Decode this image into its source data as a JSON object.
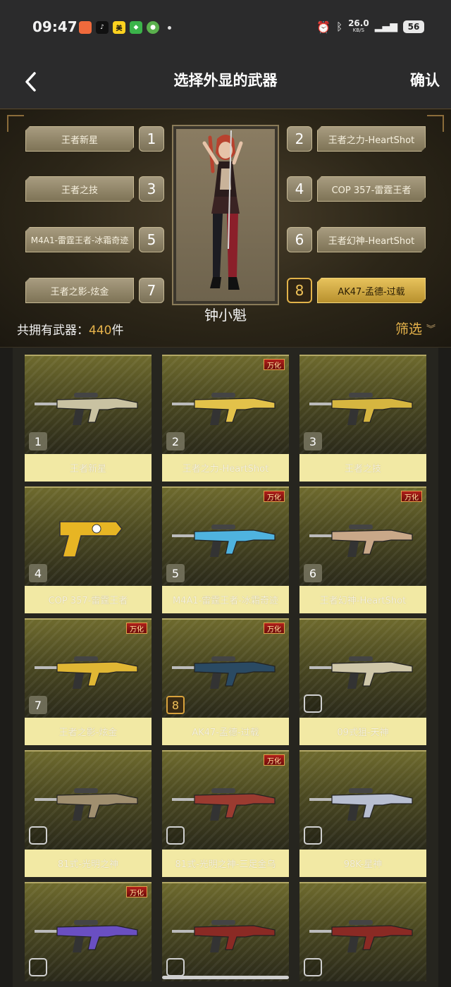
{
  "status_bar": {
    "time": "09:47",
    "apps": [
      "game-app",
      "tiktok-app",
      "meituan-app",
      "shield-app",
      "rings-app"
    ],
    "net_speed": "26.0",
    "net_unit": "KB/S",
    "battery": "56"
  },
  "nav": {
    "back_icon": "back-arrow-icon",
    "title": "选择外显的武器",
    "confirm": "确认"
  },
  "slots": {
    "left": [
      {
        "label": "王者新星",
        "num": "1"
      },
      {
        "label": "王者之技",
        "num": "3"
      },
      {
        "label": "M4A1-雷霆王者-冰霜奇迹",
        "num": "5"
      },
      {
        "label": "王者之影-炫金",
        "num": "7"
      }
    ],
    "right": [
      {
        "label": "王者之力-HeartShot",
        "num": "2"
      },
      {
        "label": "COP 357-雷霆王者",
        "num": "4"
      },
      {
        "label": "王者幻神-HeartShot",
        "num": "6"
      },
      {
        "label": "AK47-孟德-过载",
        "num": "8",
        "active": true
      }
    ]
  },
  "character_name": "钟小魁",
  "owned": {
    "prefix": "共拥有武器：",
    "count": "440",
    "suffix": "件"
  },
  "filter_label": "筛选",
  "tag_text": "万化",
  "weapons": [
    {
      "name": "王者新星",
      "badge": "1",
      "tag": false,
      "color": "#c9c2a2"
    },
    {
      "name": "王者之力-HeartShot",
      "badge": "2",
      "tag": true,
      "color": "#e3c24a"
    },
    {
      "name": "王者之技",
      "badge": "3",
      "tag": false,
      "color": "#d6b640"
    },
    {
      "name": "COP 357-雷霆王者",
      "badge": "4",
      "tag": false,
      "color": "#e7b524"
    },
    {
      "name": "M4A1-雷霆王者-冰霜奇迹",
      "badge": "5",
      "tag": true,
      "color": "#4fb3df"
    },
    {
      "name": "王者幻神-HeartShot",
      "badge": "6",
      "tag": true,
      "color": "#c9a889"
    },
    {
      "name": "王者之影-炫金",
      "badge": "7",
      "tag": true,
      "color": "#e0b734"
    },
    {
      "name": "AK47-孟德-过载",
      "badge": "8",
      "tag": true,
      "color": "#2a4a63",
      "gold": true
    },
    {
      "name": "09式狙-天神",
      "badge": "",
      "tag": false,
      "color": "#cfc7a9"
    },
    {
      "name": "81式-光明之神",
      "badge": "",
      "tag": false,
      "color": "#a08f6f"
    },
    {
      "name": "81式-光明之神-三足金乌",
      "badge": "",
      "tag": true,
      "color": "#9b3b30"
    },
    {
      "name": "98K-星神",
      "badge": "",
      "tag": false,
      "color": "#b8bfd1"
    },
    {
      "name": "",
      "badge": "",
      "tag": true,
      "color": "#6a4fc2"
    },
    {
      "name": "",
      "badge": "",
      "tag": false,
      "color": "#8a2a24"
    },
    {
      "name": "",
      "badge": "",
      "tag": false,
      "color": "#8a2a24"
    }
  ]
}
